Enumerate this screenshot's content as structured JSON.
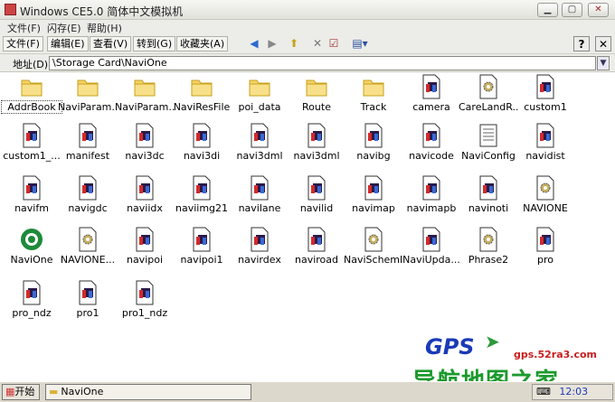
{
  "window": {
    "title": "Windows CE5.0 简体中文模拟机"
  },
  "menu": [
    "文件(F)",
    "闪存(E)",
    "帮助(H)"
  ],
  "toolbar": {
    "menus": [
      "文件(F)",
      "编辑(E)",
      "查看(V)",
      "转到(G)",
      "收藏夹(A)"
    ]
  },
  "address": {
    "label": "地址(D)",
    "value": "\\Storage Card\\NaviOne"
  },
  "files": [
    {
      "name": "AddrBook",
      "type": "folder",
      "selected": true
    },
    {
      "name": "NaviParam...",
      "type": "folder"
    },
    {
      "name": "NaviParam...",
      "type": "folder"
    },
    {
      "name": "NaviResFile",
      "type": "folder"
    },
    {
      "name": "poi_data",
      "type": "folder"
    },
    {
      "name": "Route",
      "type": "folder"
    },
    {
      "name": "Track",
      "type": "folder"
    },
    {
      "name": "camera",
      "type": "file"
    },
    {
      "name": "CareLandR...",
      "type": "gear"
    },
    {
      "name": "custom1",
      "type": "file"
    },
    {
      "name": "custom1_...",
      "type": "file"
    },
    {
      "name": "manifest",
      "type": "file"
    },
    {
      "name": "navi3dc",
      "type": "file"
    },
    {
      "name": "navi3di",
      "type": "file"
    },
    {
      "name": "navi3dml",
      "type": "file"
    },
    {
      "name": "navi3dml",
      "type": "file"
    },
    {
      "name": "navibg",
      "type": "file"
    },
    {
      "name": "navicode",
      "type": "file"
    },
    {
      "name": "NaviConfig",
      "type": "notepad"
    },
    {
      "name": "navidist",
      "type": "file"
    },
    {
      "name": "navifm",
      "type": "file"
    },
    {
      "name": "navigdc",
      "type": "file"
    },
    {
      "name": "naviidx",
      "type": "file"
    },
    {
      "name": "naviimg21",
      "type": "file"
    },
    {
      "name": "navilane",
      "type": "file"
    },
    {
      "name": "navilid",
      "type": "file"
    },
    {
      "name": "navimap",
      "type": "file"
    },
    {
      "name": "navimapb",
      "type": "file"
    },
    {
      "name": "navinoti",
      "type": "file"
    },
    {
      "name": "NAVIONE",
      "type": "gear"
    },
    {
      "name": "NaviOne",
      "type": "app"
    },
    {
      "name": "NAVIONE...",
      "type": "gear"
    },
    {
      "name": "navipoi",
      "type": "file"
    },
    {
      "name": "navipoi1",
      "type": "file"
    },
    {
      "name": "navirdex",
      "type": "file"
    },
    {
      "name": "naviroad",
      "type": "file"
    },
    {
      "name": "NaviSchemID",
      "type": "gear"
    },
    {
      "name": "NaviUpda...",
      "type": "file"
    },
    {
      "name": "Phrase2",
      "type": "gear"
    },
    {
      "name": "pro",
      "type": "file"
    },
    {
      "name": "pro_ndz",
      "type": "file"
    },
    {
      "name": "pro1",
      "type": "file"
    },
    {
      "name": "pro1_ndz",
      "type": "file"
    }
  ],
  "taskbar": {
    "start": "开始",
    "task": "NaviOne",
    "clock": "12:03"
  },
  "watermark": {
    "brand": "GPS",
    "url": "gps.52ra3.com",
    "slogan": "导航地图之家"
  }
}
